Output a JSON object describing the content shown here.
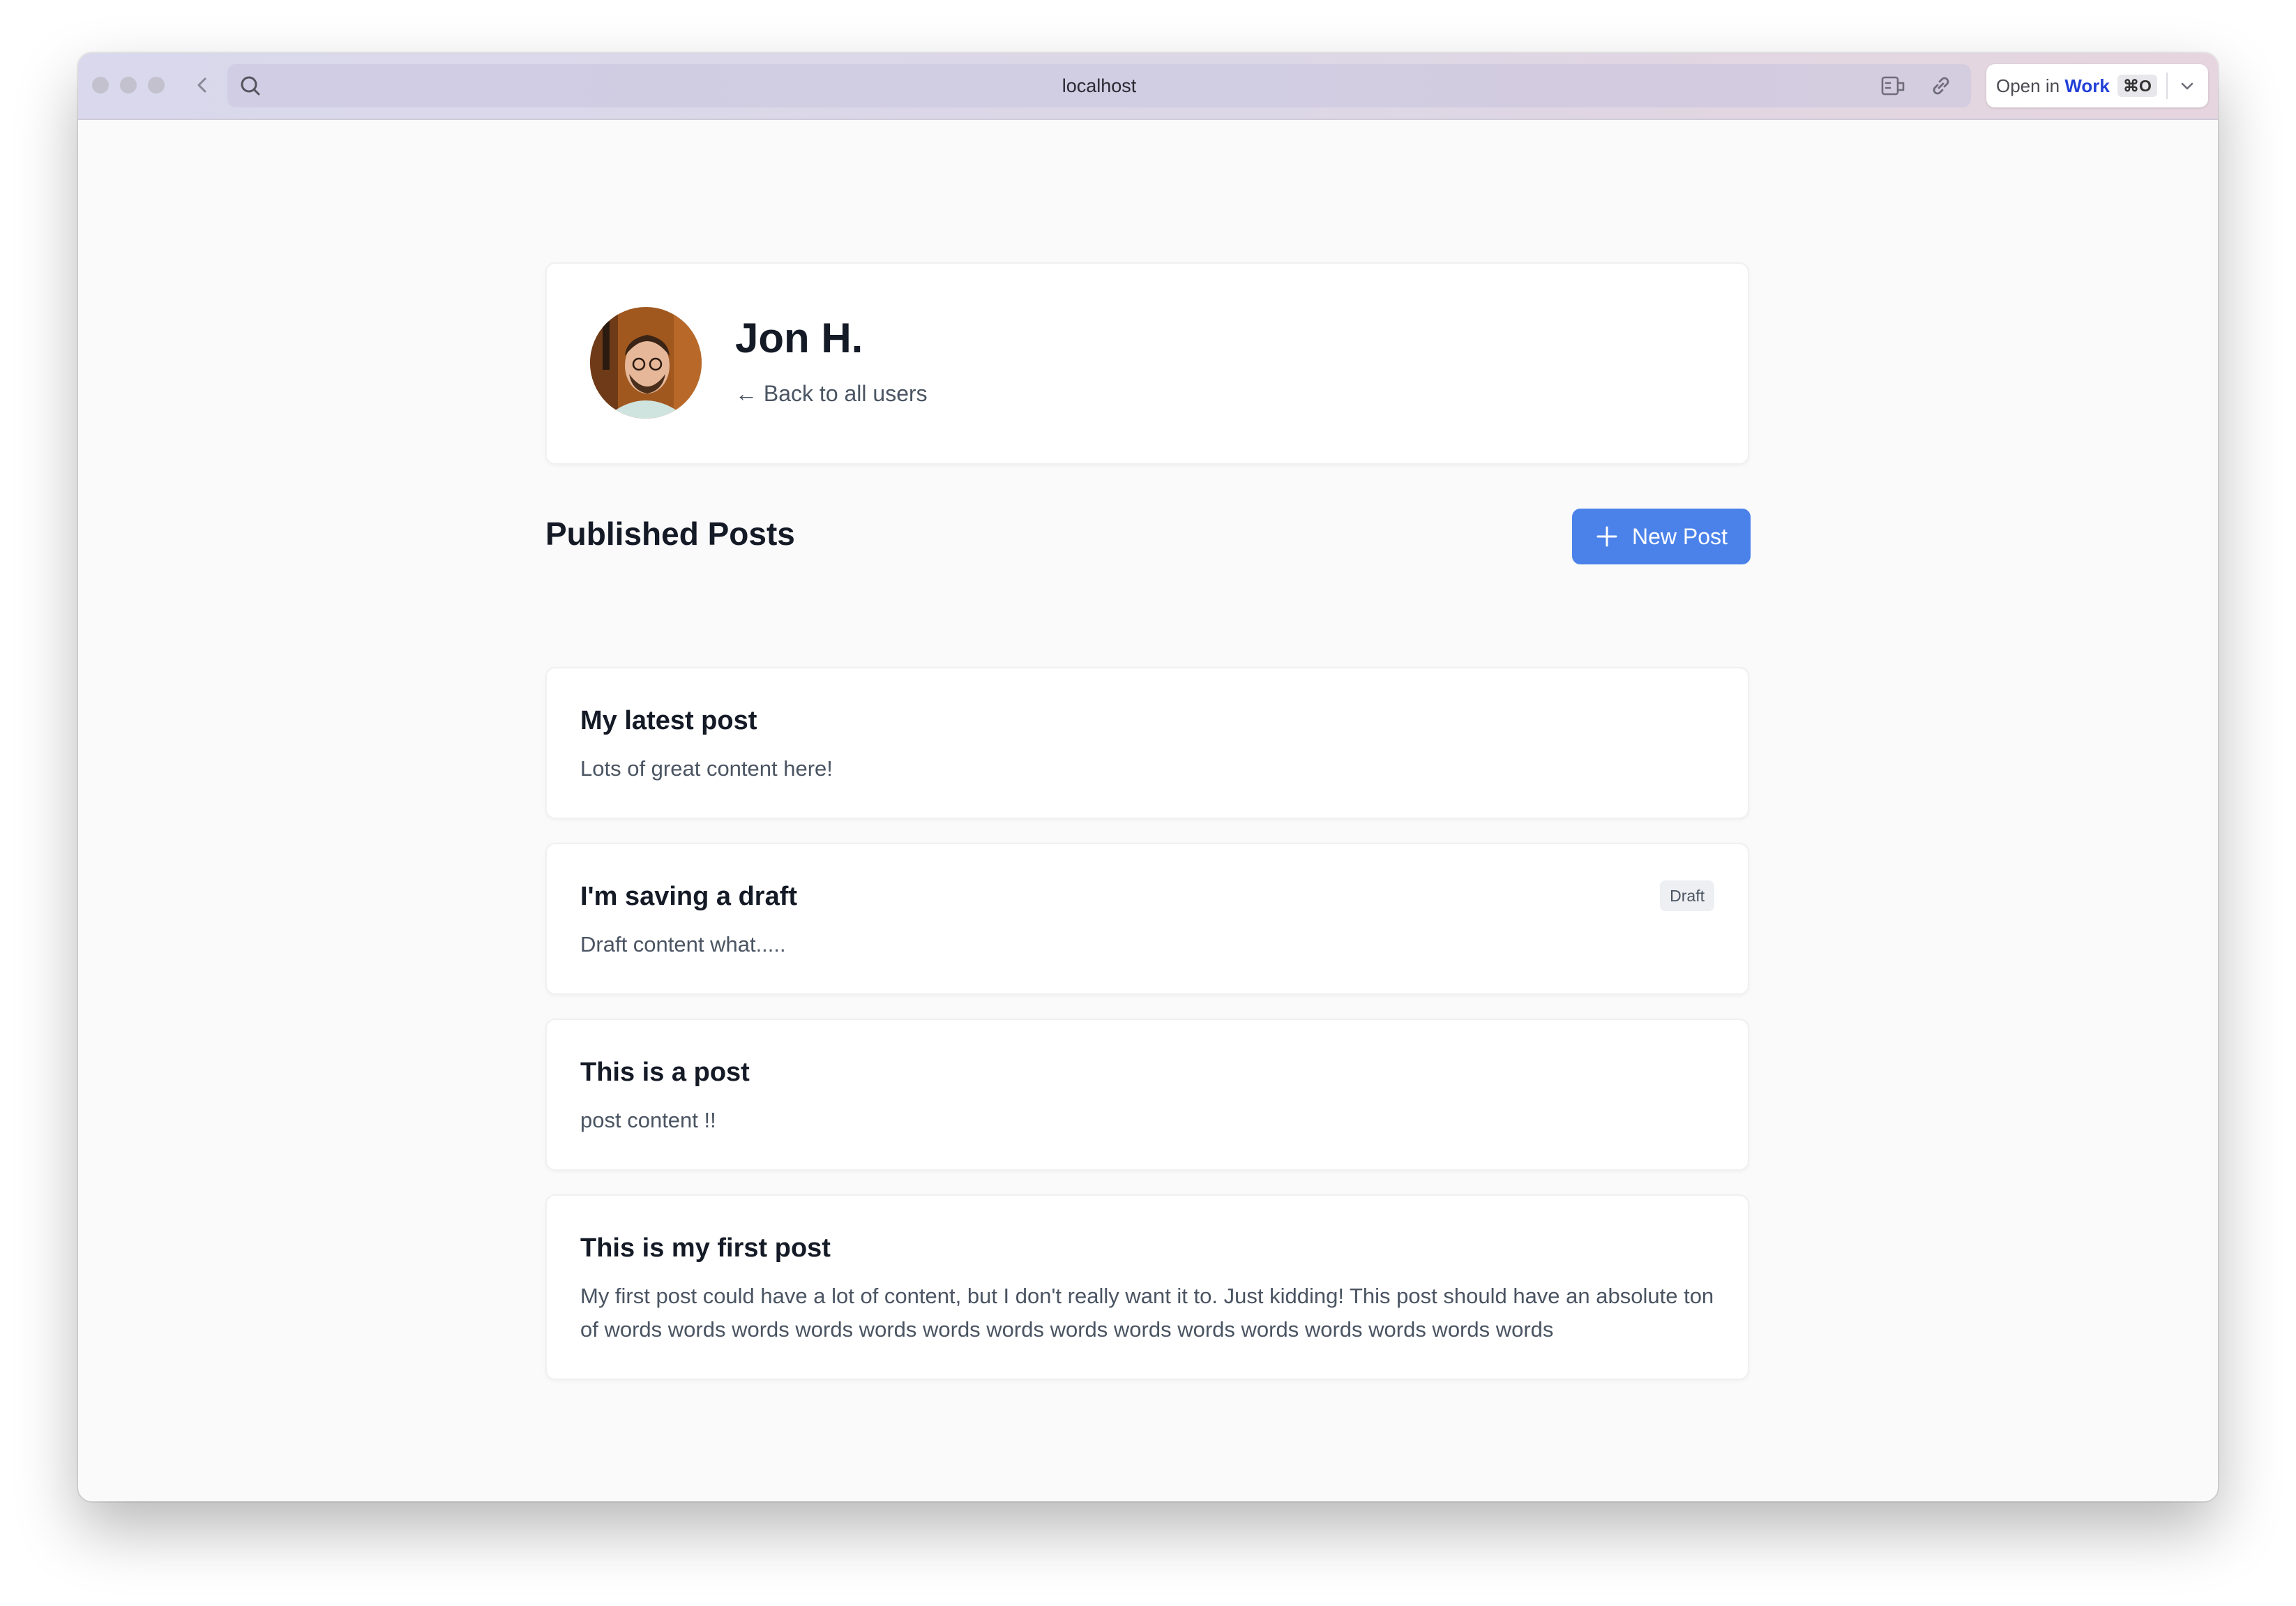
{
  "browser": {
    "url": "localhost",
    "open_in_prefix": "Open in",
    "open_in_target": "Work",
    "shortcut": "⌘O"
  },
  "profile": {
    "name": "Jon H.",
    "back_link": "← Back to all users"
  },
  "posts_section": {
    "title": "Published Posts",
    "new_post_label": "New Post"
  },
  "posts": [
    {
      "title": "My latest post",
      "body": "Lots of great content here!",
      "badge": ""
    },
    {
      "title": "I'm saving a draft",
      "body": "Draft content what.....",
      "badge": "Draft"
    },
    {
      "title": "This is a post",
      "body": "post content !!",
      "badge": ""
    },
    {
      "title": "This is my first post",
      "body": "My first post could have a lot of content, but I don't really want it to. Just kidding! This post should have an absolute ton of words words words words words words words words words words words words words words words",
      "badge": ""
    }
  ],
  "colors": {
    "accent": "#4b82ea",
    "heading": "#141a26",
    "muted_text": "#4a5462"
  }
}
